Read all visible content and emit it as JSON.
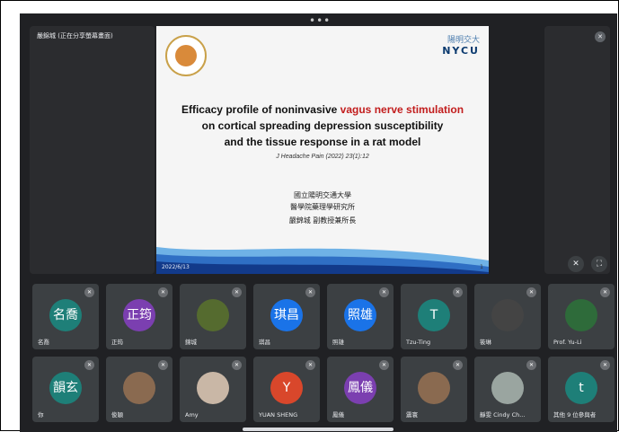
{
  "presenter": {
    "name": "嚴錦城 (正在分享螢幕畫面)"
  },
  "slide": {
    "logo_text_cn": "陽明交大",
    "logo_text": "NYCU",
    "title_line1_a": "Efficacy profile of noninvasive ",
    "title_line1_b": "vagus nerve stimulation",
    "title_line2": "on cortical spreading depression susceptibility",
    "title_line3": "and the tissue response in a rat model",
    "citation": "J Headache Pain (2022) 23(1):12",
    "affiliation1": "國立陽明交通大學",
    "affiliation2": "醫學院藥理學研究所",
    "affiliation3": "嚴錦城  副教授兼所長",
    "date": "2022/6/13",
    "page": "1"
  },
  "participants_row1": [
    {
      "initial": "名喬",
      "name": "名喬",
      "color": "#1e7f78"
    },
    {
      "initial": "正筠",
      "name": "正筠",
      "color": "#7b3fb0"
    },
    {
      "initial": "",
      "name": "錦城",
      "color": "#556b2f",
      "photo": true
    },
    {
      "initial": "琪昌",
      "name": "琪昌",
      "color": "#1a73e8"
    },
    {
      "initial": "照雄",
      "name": "照雄",
      "color": "#1a73e8"
    },
    {
      "initial": "T",
      "name": "Tzu-Ting",
      "color": "#1e7f78"
    },
    {
      "initial": "",
      "name": "筱琳",
      "color": "#444",
      "photo": true
    },
    {
      "initial": "",
      "name": "Prof. Yu-Li",
      "color": "#2e6b3a",
      "photo": true
    }
  ],
  "participants_row2": [
    {
      "initial": "韻玄",
      "name": "你",
      "color": "#1e7f78"
    },
    {
      "initial": "",
      "name": "俊穎",
      "color": "#8a6a50",
      "photo": true
    },
    {
      "initial": "",
      "name": "Amy",
      "color": "#c9b7a6",
      "photo": true
    },
    {
      "initial": "Y",
      "name": "YUAN SHENG",
      "color": "#d9472b"
    },
    {
      "initial": "鳳儀",
      "name": "鳳儀",
      "color": "#7b3fb0"
    },
    {
      "initial": "",
      "name": "震寰",
      "color": "#8a6a50",
      "photo": true
    },
    {
      "initial": "",
      "name": "靜雯 Cindy Ch...",
      "color": "#9aa5a0",
      "photo": true
    },
    {
      "initial": "t",
      "name": "其他 9 位參與者",
      "color": "#1e7f78"
    }
  ]
}
